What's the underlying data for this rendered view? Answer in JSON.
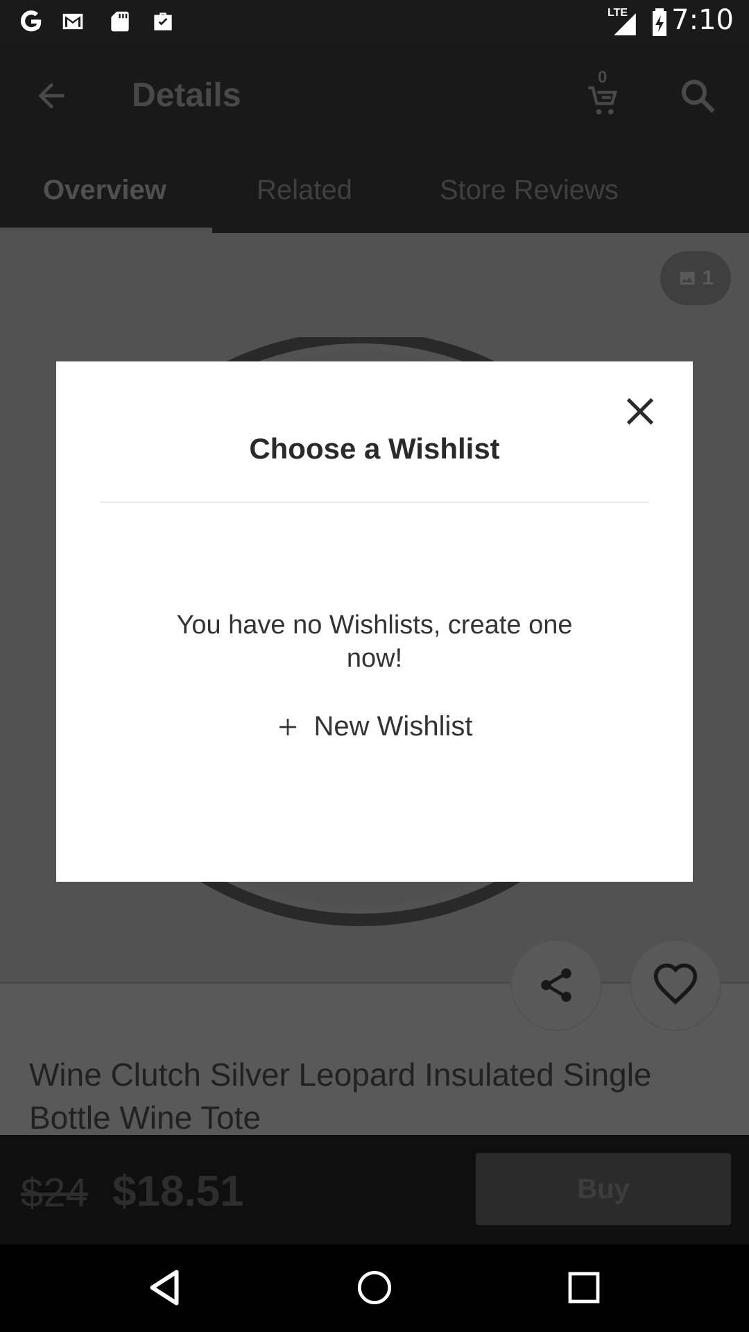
{
  "status_bar": {
    "time": "7:10",
    "network": "LTE",
    "left_icons": [
      "google-icon",
      "gmail-icon",
      "sd-card-icon",
      "briefcase-check-icon"
    ]
  },
  "appbar": {
    "title": "Details",
    "cart_count": "0"
  },
  "tabs": [
    {
      "label": "Overview",
      "active": true
    },
    {
      "label": "Related",
      "active": false
    },
    {
      "label": "Store Reviews",
      "active": false
    }
  ],
  "product": {
    "image_count": "1",
    "title": "Wine Clutch Silver Leopard Insulated Single Bottle Wine Tote",
    "price_old": "$24",
    "price_new": "$18.51",
    "buy_label": "Buy"
  },
  "dialog": {
    "title": "Choose a Wishlist",
    "empty_message": "You have no Wishlists, create one now!",
    "new_wishlist_label": "New Wishlist"
  }
}
